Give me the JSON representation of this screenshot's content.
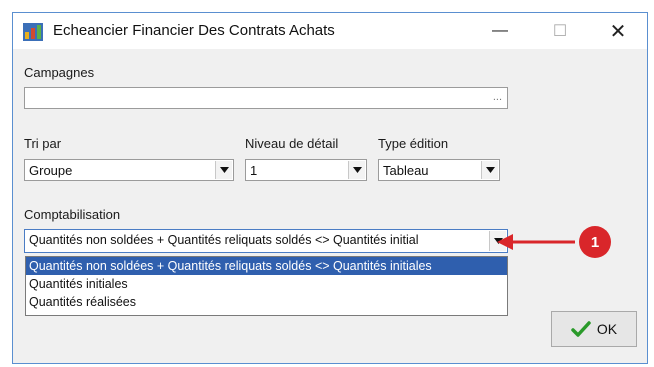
{
  "window": {
    "title": "Echeancier Financier Des Contrats Achats",
    "controls": {
      "minimize": "—",
      "maximize": "☐",
      "close": "✕"
    }
  },
  "campagnes": {
    "label": "Campagnes",
    "value": "",
    "browse": "..."
  },
  "tri_par": {
    "label": "Tri par",
    "value": "Groupe"
  },
  "niveau": {
    "label": "Niveau de détail",
    "value": "1"
  },
  "type_edition": {
    "label": "Type édition",
    "value": "Tableau"
  },
  "comptabilisation": {
    "label": "Comptabilisation",
    "value": "Quantités non soldées + Quantités reliquats soldés <> Quantités initial",
    "options": [
      "Quantités non soldées + Quantités reliquats soldés <> Quantités initiales",
      "Quantités initiales",
      "Quantités réalisées"
    ]
  },
  "ok_button": {
    "label": "OK"
  },
  "callout": {
    "number": "1",
    "color": "#d9262a"
  },
  "colors": {
    "selection": "#2f5fae",
    "ok_check": "#2a9a2a",
    "border": "#5a8fd0"
  }
}
